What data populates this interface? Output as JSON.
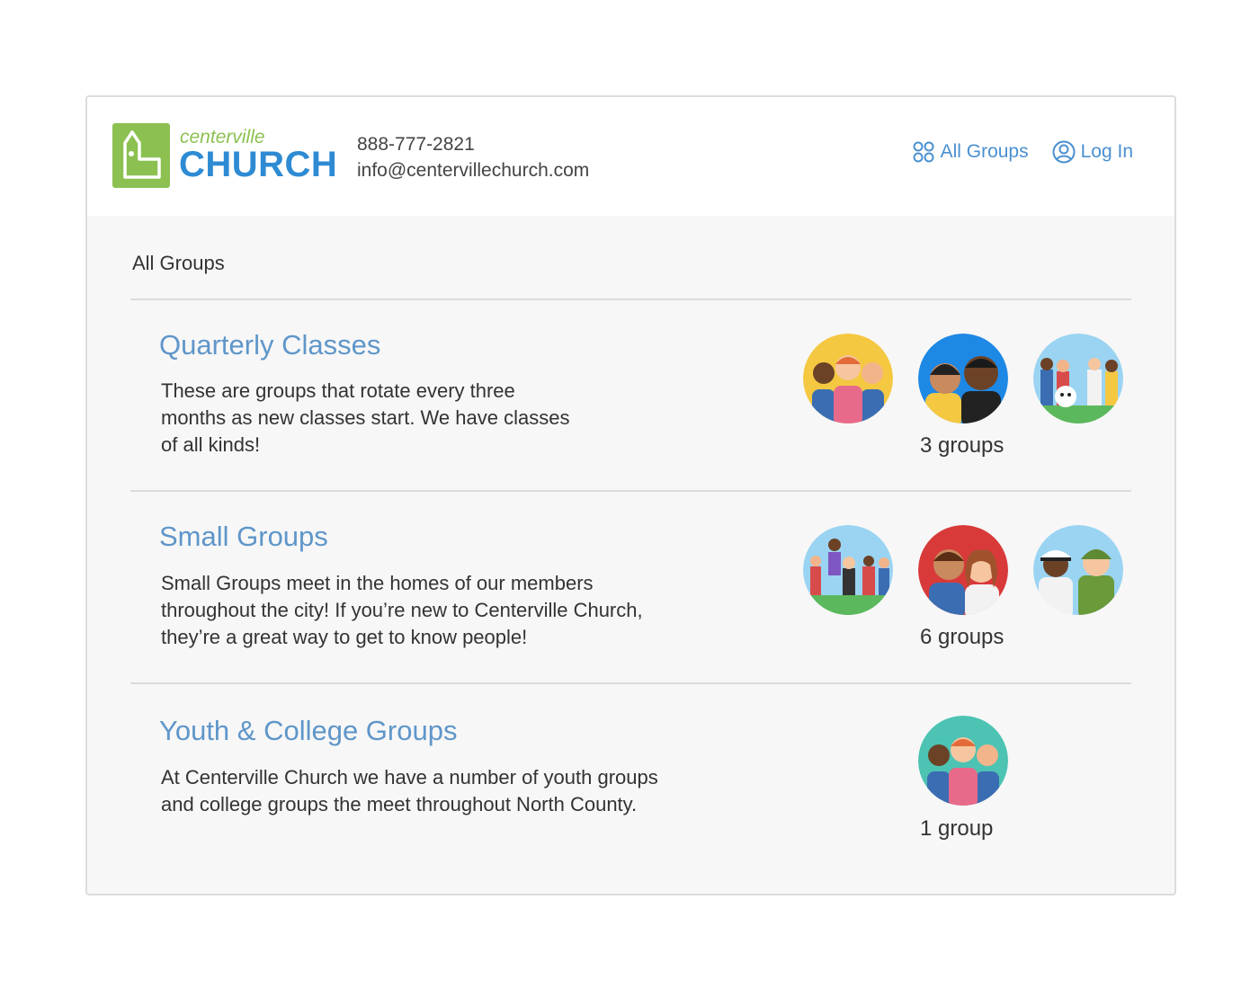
{
  "header": {
    "logo": {
      "small": "centerville",
      "big": "CHURCH"
    },
    "phone": "888-777-2821",
    "email": "info@centervillechurch.com",
    "nav": [
      {
        "label": "All Groups",
        "icon": "groups-icon"
      },
      {
        "label": "Log In",
        "icon": "user-icon"
      }
    ]
  },
  "main": {
    "title": "All Groups",
    "groups": [
      {
        "title": "Quarterly Classes",
        "description": "These are groups that rotate every three months as new classes start. We have classes of all kinds!",
        "count": "3 groups",
        "avatars": [
          {
            "name": "quarterly-avatar-1",
            "bg": "#f5c842"
          },
          {
            "name": "quarterly-avatar-2",
            "bg": "#1e88e5"
          },
          {
            "name": "quarterly-avatar-3",
            "bg": "#9ad4f2"
          }
        ]
      },
      {
        "title": "Small Groups",
        "description": "Small Groups meet in the homes of our members throughout the city! If you’re new to Centerville Church, they’re a great way to get to know people!",
        "count": "6 groups",
        "avatars": [
          {
            "name": "small-avatar-1",
            "bg": "#9ad4f2"
          },
          {
            "name": "small-avatar-2",
            "bg": "#d83a3a"
          },
          {
            "name": "small-avatar-3",
            "bg": "#9ad4f2"
          }
        ]
      },
      {
        "title": "Youth & College Groups",
        "description": "At Centerville Church we have a number of youth groups and college groups the meet throughout North County.",
        "count": "1 group",
        "avatars": [
          {
            "name": "youth-avatar-1",
            "bg": "#4cc3b3"
          }
        ]
      }
    ]
  },
  "colors": {
    "brand_green": "#8cc152",
    "brand_blue": "#2e8bd3",
    "link_blue": "#5f96c9",
    "divider": "#dcdcdc",
    "content_bg": "#f7f7f7"
  }
}
